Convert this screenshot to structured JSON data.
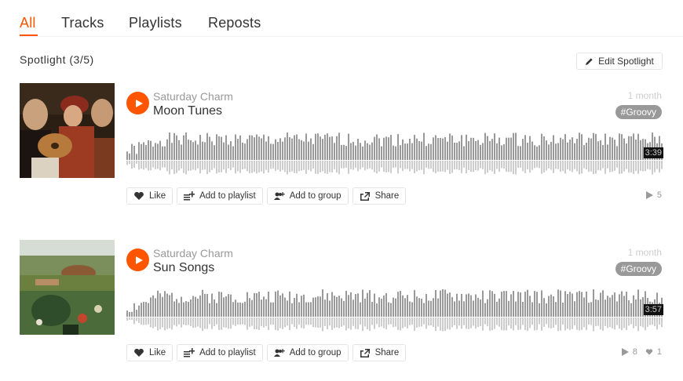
{
  "tabs": [
    {
      "label": "All",
      "active": true
    },
    {
      "label": "Tracks",
      "active": false
    },
    {
      "label": "Playlists",
      "active": false
    },
    {
      "label": "Reposts",
      "active": false
    }
  ],
  "spotlight": {
    "title": "Spotlight (3/5)",
    "edit_label": "Edit Spotlight"
  },
  "tracks": [
    {
      "artist": "Saturday Charm",
      "title": "Moon Tunes",
      "age": "1 month",
      "tag": "#Groovy",
      "duration": "3:39",
      "plays": "5",
      "likes": "",
      "actions": {
        "like": "Like",
        "add_to_playlist": "Add to playlist",
        "add_to_group": "Add to group",
        "share": "Share"
      }
    },
    {
      "artist": "Saturday Charm",
      "title": "Sun Songs",
      "age": "1 month",
      "tag": "#Groovy",
      "duration": "3:57",
      "plays": "8",
      "likes": "1",
      "actions": {
        "like": "Like",
        "add_to_playlist": "Add to playlist",
        "add_to_group": "Add to group",
        "share": "Share"
      }
    }
  ],
  "colors": {
    "accent": "#ff5500",
    "wave": "#999999",
    "wave_reflect": "#cccccc"
  },
  "icons": [
    "pencil-icon",
    "play-icon",
    "heart-icon",
    "playlist-add-icon",
    "group-add-icon",
    "share-icon",
    "play-count-icon",
    "like-count-icon"
  ]
}
